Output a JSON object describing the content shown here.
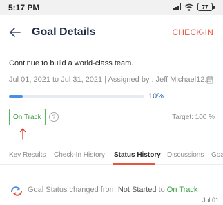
{
  "status_bar": {
    "time": "5:17 PM",
    "battery": "77"
  },
  "header": {
    "title": "Goal Details",
    "checkin_label": "CHECK-IN"
  },
  "goal": {
    "title": "Continue to build a world-class team.",
    "meta": "Jul 01, 2021 to Jul 31, 2021 | Assigned by : Jeff Michael12...",
    "progress": 10,
    "progress_label": "10%",
    "status": "On Track",
    "target": "Target: 100 %",
    "help_label": "?"
  },
  "tabs": [
    {
      "label": "Key Results",
      "active": false
    },
    {
      "label": "Check-In History",
      "active": false
    },
    {
      "label": "Status History",
      "active": true
    },
    {
      "label": "Discussions",
      "active": false
    },
    {
      "label": "Goa",
      "active": false
    }
  ],
  "history": [
    {
      "prefix": "Goal Status changed from ",
      "from": "Not Started",
      "middle": " to ",
      "to": "On Track",
      "date": "Jul 01"
    }
  ],
  "colors": {
    "accent": "#e8543e",
    "progress": "#4a90e2",
    "on_track": "#3aa040",
    "title": "#1f2b46"
  },
  "icons": [
    "back-arrow-icon",
    "calendar-icon",
    "help-icon",
    "up-arrow-icon",
    "refresh-icon",
    "signal-icon",
    "wifi-icon",
    "battery-icon"
  ]
}
